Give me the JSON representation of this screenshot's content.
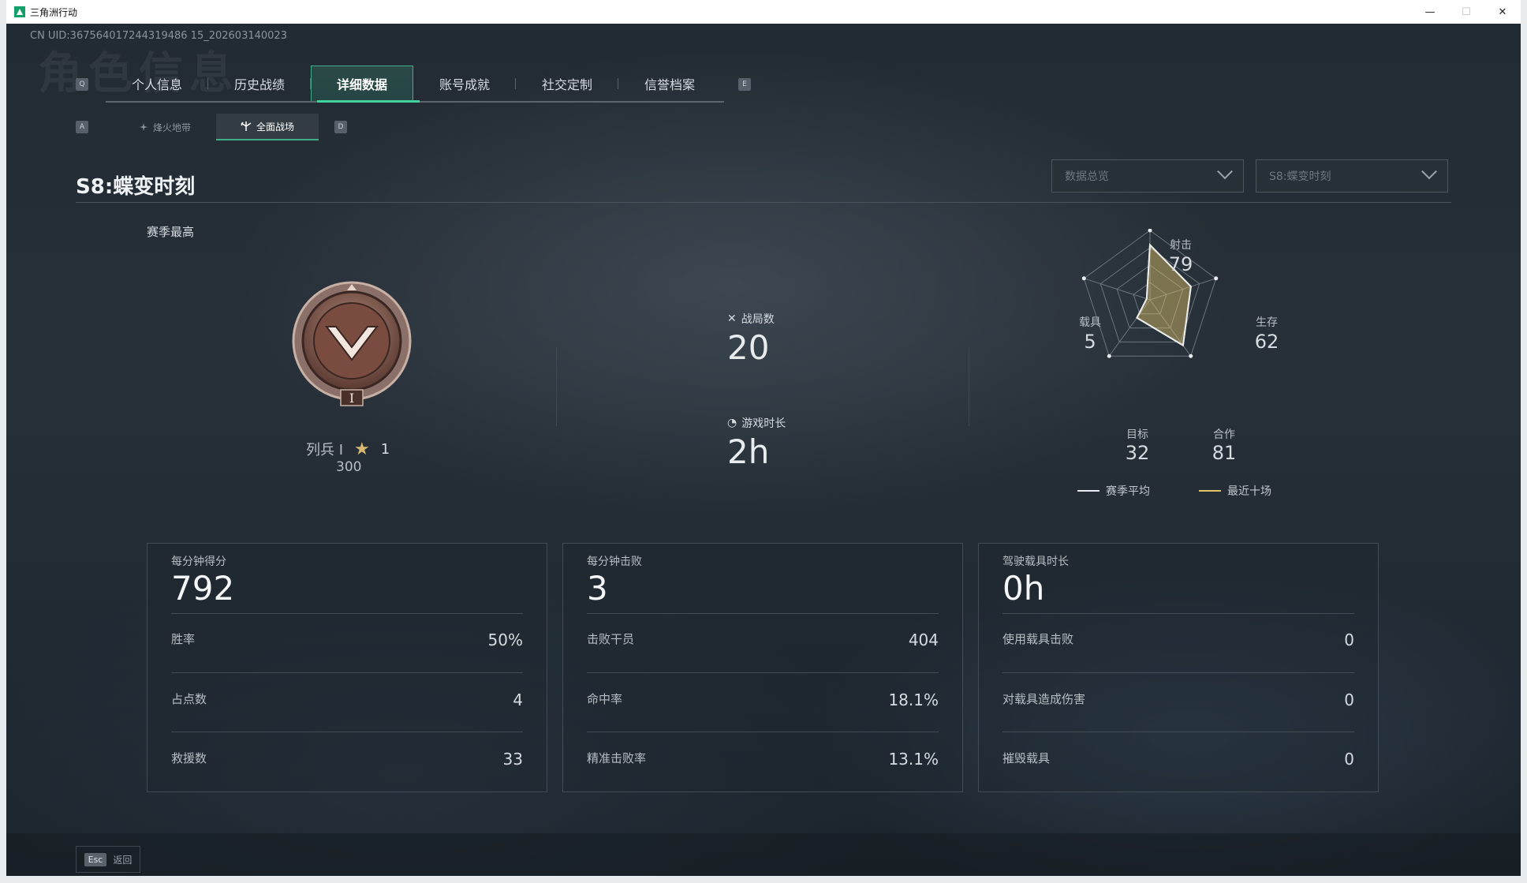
{
  "window": {
    "title": "三角洲行动",
    "minimize": "—",
    "maximize": "☐",
    "close": "✕"
  },
  "uid": "CN UID:367564017244319486 15_202603140023",
  "watermark": "角色信息",
  "tabs": {
    "left_key": "Q",
    "right_key": "E",
    "items": [
      "个人信息",
      "历史战绩",
      "详细数据",
      "账号成就",
      "社交定制",
      "信誉档案"
    ],
    "active_index": 2
  },
  "subtabs": {
    "left_key": "A",
    "right_key": "D",
    "items": [
      {
        "label": "烽火地带",
        "icon": "operations-icon"
      },
      {
        "label": "全面战场",
        "icon": "warfare-icon"
      }
    ],
    "active_index": 1
  },
  "season": {
    "title": "S8:蝶变时刻",
    "filter_overview": "数据总览",
    "filter_season": "S8:蝶变时刻"
  },
  "season_best": {
    "label": "赛季最高",
    "rank_name": "列兵 I",
    "rank_numeral": "I",
    "stars": "1",
    "score": "300"
  },
  "match_stats": {
    "matches_label": "战局数",
    "matches_value": "20",
    "duration_label": "游戏时长",
    "duration_value": "2h"
  },
  "radar": {
    "axes": [
      {
        "label": "射击",
        "value": "79"
      },
      {
        "label": "生存",
        "value": "62"
      },
      {
        "label": "合作",
        "value": "81"
      },
      {
        "label": "目标",
        "value": "32"
      },
      {
        "label": "载具",
        "value": "5"
      }
    ],
    "legend_season_avg": "赛季平均",
    "legend_recent_ten": "最近十场",
    "colors": {
      "season_avg": "#e8ecef",
      "recent_ten": "#e2c46a"
    }
  },
  "cards": [
    {
      "title": "每分钟得分",
      "big": "792",
      "rows": [
        {
          "label": "胜率",
          "value": "50%"
        },
        {
          "label": "占点数",
          "value": "4"
        },
        {
          "label": "救援数",
          "value": "33"
        }
      ]
    },
    {
      "title": "每分钟击败",
      "big": "3",
      "rows": [
        {
          "label": "击败干员",
          "value": "404"
        },
        {
          "label": "命中率",
          "value": "18.1%"
        },
        {
          "label": "精准击败率",
          "value": "13.1%"
        }
      ]
    },
    {
      "title": "驾驶载具时长",
      "big": "0h",
      "rows": [
        {
          "label": "使用载具击败",
          "value": "0"
        },
        {
          "label": "对载具造成伤害",
          "value": "0"
        },
        {
          "label": "摧毁载具",
          "value": "0"
        }
      ]
    }
  ],
  "back": {
    "key": "Esc",
    "label": "返回"
  }
}
